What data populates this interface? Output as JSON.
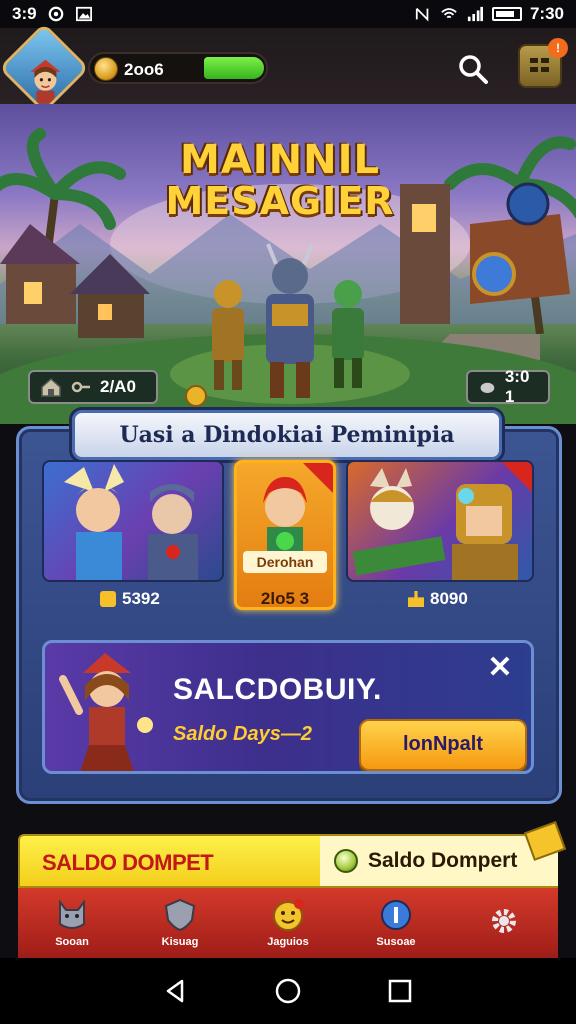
{
  "status_bar": {
    "time_left": "3:9",
    "time_right": "7:30"
  },
  "top_bar": {
    "coins": "2oo6",
    "notification_count": "!"
  },
  "hero": {
    "title_line1": "MAINNIL",
    "title_line2": "MESAGIER",
    "left_stat": "2/А0",
    "right_stat": "3:0 1"
  },
  "panel": {
    "title": "Uasi a Dindokiai Peminipia",
    "cards": [
      {
        "label": "",
        "price": "5392"
      },
      {
        "label": "Derohan",
        "price": "2lo5 3"
      },
      {
        "label": "",
        "price": "8090"
      }
    ]
  },
  "promo": {
    "title": "SALCDOBUIY.",
    "subtitle": "Saldo Days—2",
    "button": "lonNpalt",
    "close": "✕"
  },
  "bottom_banner": {
    "left_text": "SALDO DOMPET",
    "right_text": "Saldo Dompert"
  },
  "nav": {
    "items": [
      {
        "label": "Sooan",
        "icon": "cat-icon"
      },
      {
        "label": "Kisuag",
        "icon": "shield-icon"
      },
      {
        "label": "Jaguios",
        "icon": "emoji-icon"
      },
      {
        "label": "Susoae",
        "icon": "info-icon"
      },
      {
        "label": "",
        "icon": "gear-icon"
      }
    ]
  },
  "colors": {
    "panel": "#3c5593",
    "accent_gold": "#ffd23a",
    "nav_red": "#d33a2a",
    "banner_yellow": "#fdf04a"
  }
}
